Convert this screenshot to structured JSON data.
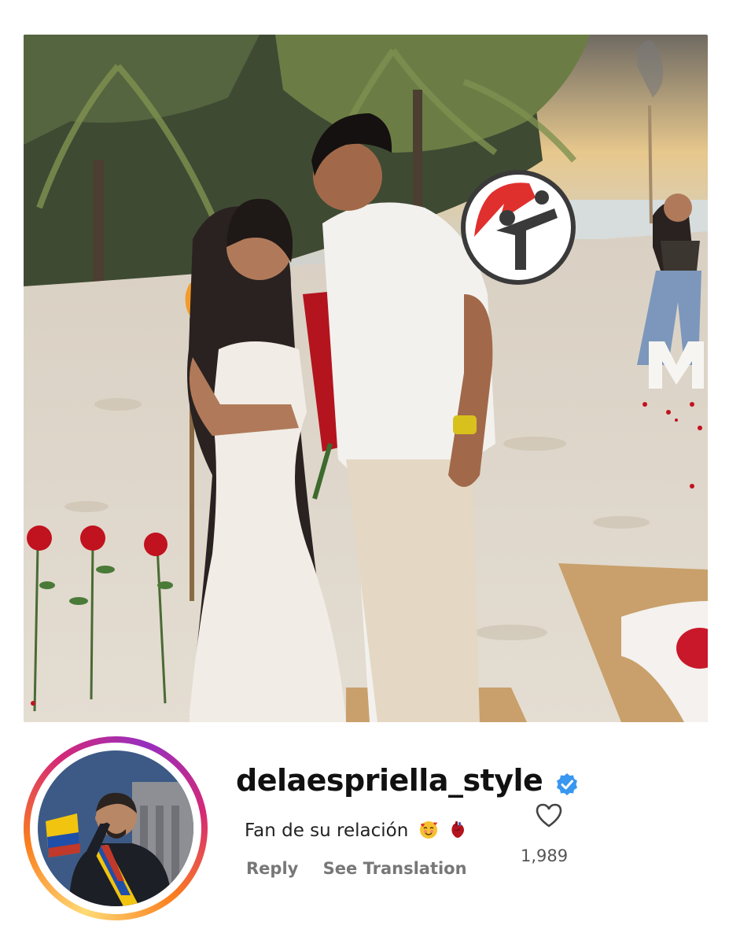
{
  "post": {
    "image_alt": "Couple on the beach at sunset holding a bouquet of red roses"
  },
  "badge": {
    "icon": "sports-brand-logo-icon",
    "colors": {
      "red": "#e0302e",
      "dark": "#3a3a3a"
    }
  },
  "comment": {
    "username": "delaespriella_style",
    "verified": true,
    "text": "Fan de su relación",
    "emojis": [
      "smiling-face-with-hearts",
      "anatomical-heart"
    ],
    "reply_label": "Reply",
    "translation_label": "See Translation",
    "like_count": "1,989"
  },
  "colors": {
    "verified_blue": "#3897f0",
    "ring_gradient": [
      "#feda75",
      "#fa7e1e",
      "#d62976",
      "#962fbf"
    ]
  }
}
